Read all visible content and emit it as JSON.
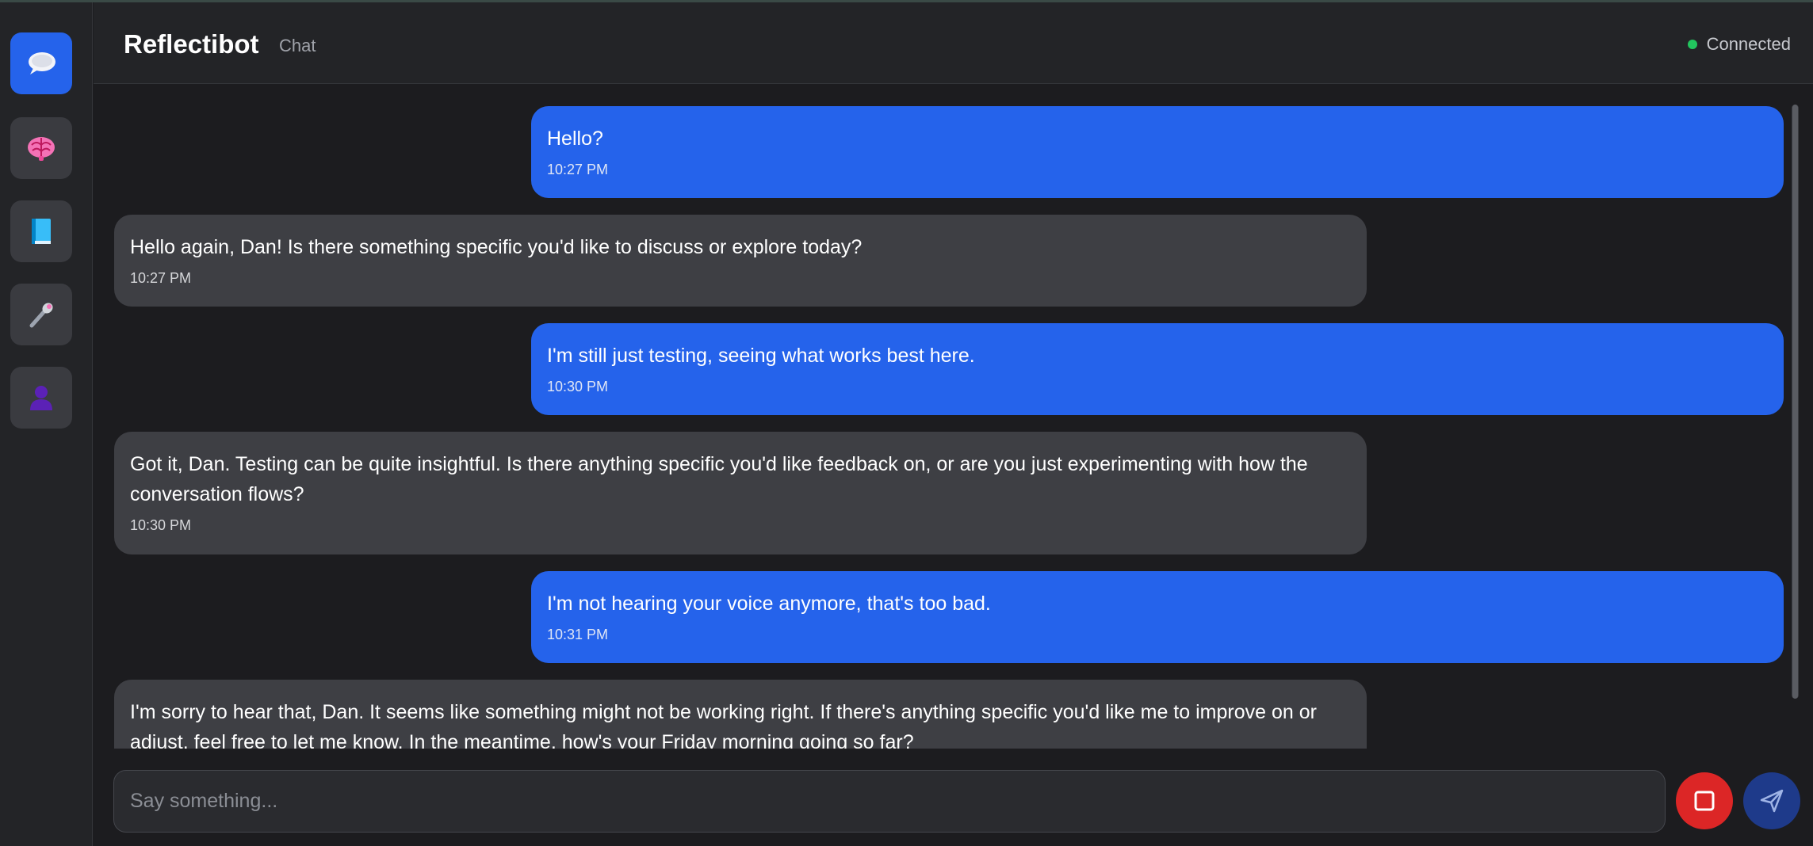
{
  "app": {
    "title": "Reflectibot",
    "section": "Chat",
    "status": "Connected",
    "status_color": "#22c55e",
    "accent_color": "#2563eb"
  },
  "sidebar": {
    "items": [
      {
        "name": "chat",
        "icon": "speech-bubble-icon",
        "active": true
      },
      {
        "name": "brain",
        "icon": "brain-icon",
        "active": false
      },
      {
        "name": "journal",
        "icon": "book-icon",
        "active": false
      },
      {
        "name": "microphone",
        "icon": "microphone-icon",
        "active": false
      },
      {
        "name": "profile",
        "icon": "user-silhouette-icon",
        "active": false
      }
    ]
  },
  "messages": [
    {
      "role": "user",
      "text": "Hello?",
      "time": "10:27 PM"
    },
    {
      "role": "bot",
      "text": "Hello again, Dan! Is there something specific you'd like to discuss or explore today?",
      "time": "10:27 PM"
    },
    {
      "role": "user",
      "text": "I'm still just testing, seeing what works best here.",
      "time": "10:30 PM"
    },
    {
      "role": "bot",
      "text": "Got it, Dan. Testing can be quite insightful. Is there anything specific you'd like feedback on, or are you just experimenting with how the conversation flows?",
      "time": "10:30 PM"
    },
    {
      "role": "user",
      "text": "I'm not hearing your voice anymore, that's too bad.",
      "time": "10:31 PM"
    },
    {
      "role": "bot",
      "text": "I'm sorry to hear that, Dan. It seems like something might not be working right. If there's anything specific you'd like me to improve on or adjust, feel free to let me know. In the meantime, how's your Friday morning going so far?",
      "time": ""
    }
  ],
  "composer": {
    "placeholder": "Say something...",
    "stop_icon": "stop-square-icon",
    "send_icon": "paper-plane-icon"
  }
}
